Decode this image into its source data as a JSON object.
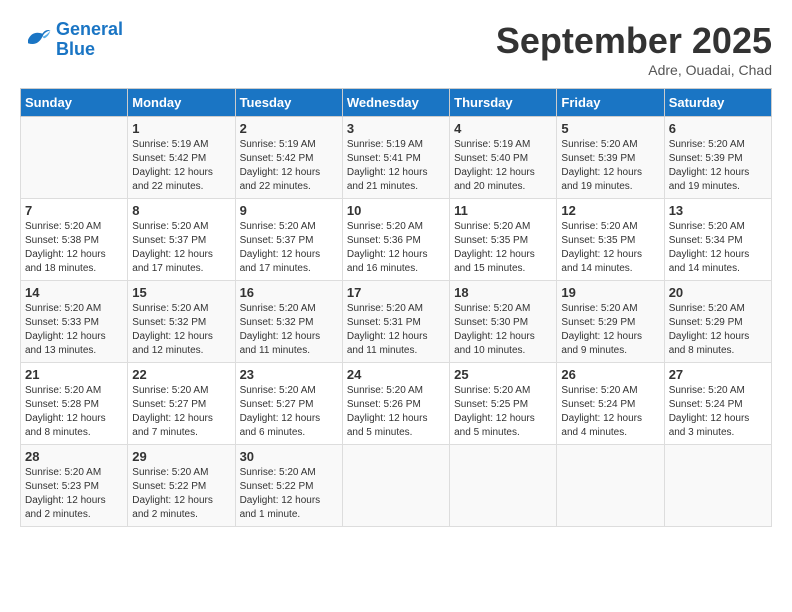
{
  "header": {
    "logo_line1": "General",
    "logo_line2": "Blue",
    "month": "September 2025",
    "location": "Adre, Ouadai, Chad"
  },
  "days_of_week": [
    "Sunday",
    "Monday",
    "Tuesday",
    "Wednesday",
    "Thursday",
    "Friday",
    "Saturday"
  ],
  "weeks": [
    [
      {
        "day": "",
        "info": ""
      },
      {
        "day": "1",
        "info": "Sunrise: 5:19 AM\nSunset: 5:42 PM\nDaylight: 12 hours\nand 22 minutes."
      },
      {
        "day": "2",
        "info": "Sunrise: 5:19 AM\nSunset: 5:42 PM\nDaylight: 12 hours\nand 22 minutes."
      },
      {
        "day": "3",
        "info": "Sunrise: 5:19 AM\nSunset: 5:41 PM\nDaylight: 12 hours\nand 21 minutes."
      },
      {
        "day": "4",
        "info": "Sunrise: 5:19 AM\nSunset: 5:40 PM\nDaylight: 12 hours\nand 20 minutes."
      },
      {
        "day": "5",
        "info": "Sunrise: 5:20 AM\nSunset: 5:39 PM\nDaylight: 12 hours\nand 19 minutes."
      },
      {
        "day": "6",
        "info": "Sunrise: 5:20 AM\nSunset: 5:39 PM\nDaylight: 12 hours\nand 19 minutes."
      }
    ],
    [
      {
        "day": "7",
        "info": "Sunrise: 5:20 AM\nSunset: 5:38 PM\nDaylight: 12 hours\nand 18 minutes."
      },
      {
        "day": "8",
        "info": "Sunrise: 5:20 AM\nSunset: 5:37 PM\nDaylight: 12 hours\nand 17 minutes."
      },
      {
        "day": "9",
        "info": "Sunrise: 5:20 AM\nSunset: 5:37 PM\nDaylight: 12 hours\nand 17 minutes."
      },
      {
        "day": "10",
        "info": "Sunrise: 5:20 AM\nSunset: 5:36 PM\nDaylight: 12 hours\nand 16 minutes."
      },
      {
        "day": "11",
        "info": "Sunrise: 5:20 AM\nSunset: 5:35 PM\nDaylight: 12 hours\nand 15 minutes."
      },
      {
        "day": "12",
        "info": "Sunrise: 5:20 AM\nSunset: 5:35 PM\nDaylight: 12 hours\nand 14 minutes."
      },
      {
        "day": "13",
        "info": "Sunrise: 5:20 AM\nSunset: 5:34 PM\nDaylight: 12 hours\nand 14 minutes."
      }
    ],
    [
      {
        "day": "14",
        "info": "Sunrise: 5:20 AM\nSunset: 5:33 PM\nDaylight: 12 hours\nand 13 minutes."
      },
      {
        "day": "15",
        "info": "Sunrise: 5:20 AM\nSunset: 5:32 PM\nDaylight: 12 hours\nand 12 minutes."
      },
      {
        "day": "16",
        "info": "Sunrise: 5:20 AM\nSunset: 5:32 PM\nDaylight: 12 hours\nand 11 minutes."
      },
      {
        "day": "17",
        "info": "Sunrise: 5:20 AM\nSunset: 5:31 PM\nDaylight: 12 hours\nand 11 minutes."
      },
      {
        "day": "18",
        "info": "Sunrise: 5:20 AM\nSunset: 5:30 PM\nDaylight: 12 hours\nand 10 minutes."
      },
      {
        "day": "19",
        "info": "Sunrise: 5:20 AM\nSunset: 5:29 PM\nDaylight: 12 hours\nand 9 minutes."
      },
      {
        "day": "20",
        "info": "Sunrise: 5:20 AM\nSunset: 5:29 PM\nDaylight: 12 hours\nand 8 minutes."
      }
    ],
    [
      {
        "day": "21",
        "info": "Sunrise: 5:20 AM\nSunset: 5:28 PM\nDaylight: 12 hours\nand 8 minutes."
      },
      {
        "day": "22",
        "info": "Sunrise: 5:20 AM\nSunset: 5:27 PM\nDaylight: 12 hours\nand 7 minutes."
      },
      {
        "day": "23",
        "info": "Sunrise: 5:20 AM\nSunset: 5:27 PM\nDaylight: 12 hours\nand 6 minutes."
      },
      {
        "day": "24",
        "info": "Sunrise: 5:20 AM\nSunset: 5:26 PM\nDaylight: 12 hours\nand 5 minutes."
      },
      {
        "day": "25",
        "info": "Sunrise: 5:20 AM\nSunset: 5:25 PM\nDaylight: 12 hours\nand 5 minutes."
      },
      {
        "day": "26",
        "info": "Sunrise: 5:20 AM\nSunset: 5:24 PM\nDaylight: 12 hours\nand 4 minutes."
      },
      {
        "day": "27",
        "info": "Sunrise: 5:20 AM\nSunset: 5:24 PM\nDaylight: 12 hours\nand 3 minutes."
      }
    ],
    [
      {
        "day": "28",
        "info": "Sunrise: 5:20 AM\nSunset: 5:23 PM\nDaylight: 12 hours\nand 2 minutes."
      },
      {
        "day": "29",
        "info": "Sunrise: 5:20 AM\nSunset: 5:22 PM\nDaylight: 12 hours\nand 2 minutes."
      },
      {
        "day": "30",
        "info": "Sunrise: 5:20 AM\nSunset: 5:22 PM\nDaylight: 12 hours\nand 1 minute."
      },
      {
        "day": "",
        "info": ""
      },
      {
        "day": "",
        "info": ""
      },
      {
        "day": "",
        "info": ""
      },
      {
        "day": "",
        "info": ""
      }
    ]
  ]
}
